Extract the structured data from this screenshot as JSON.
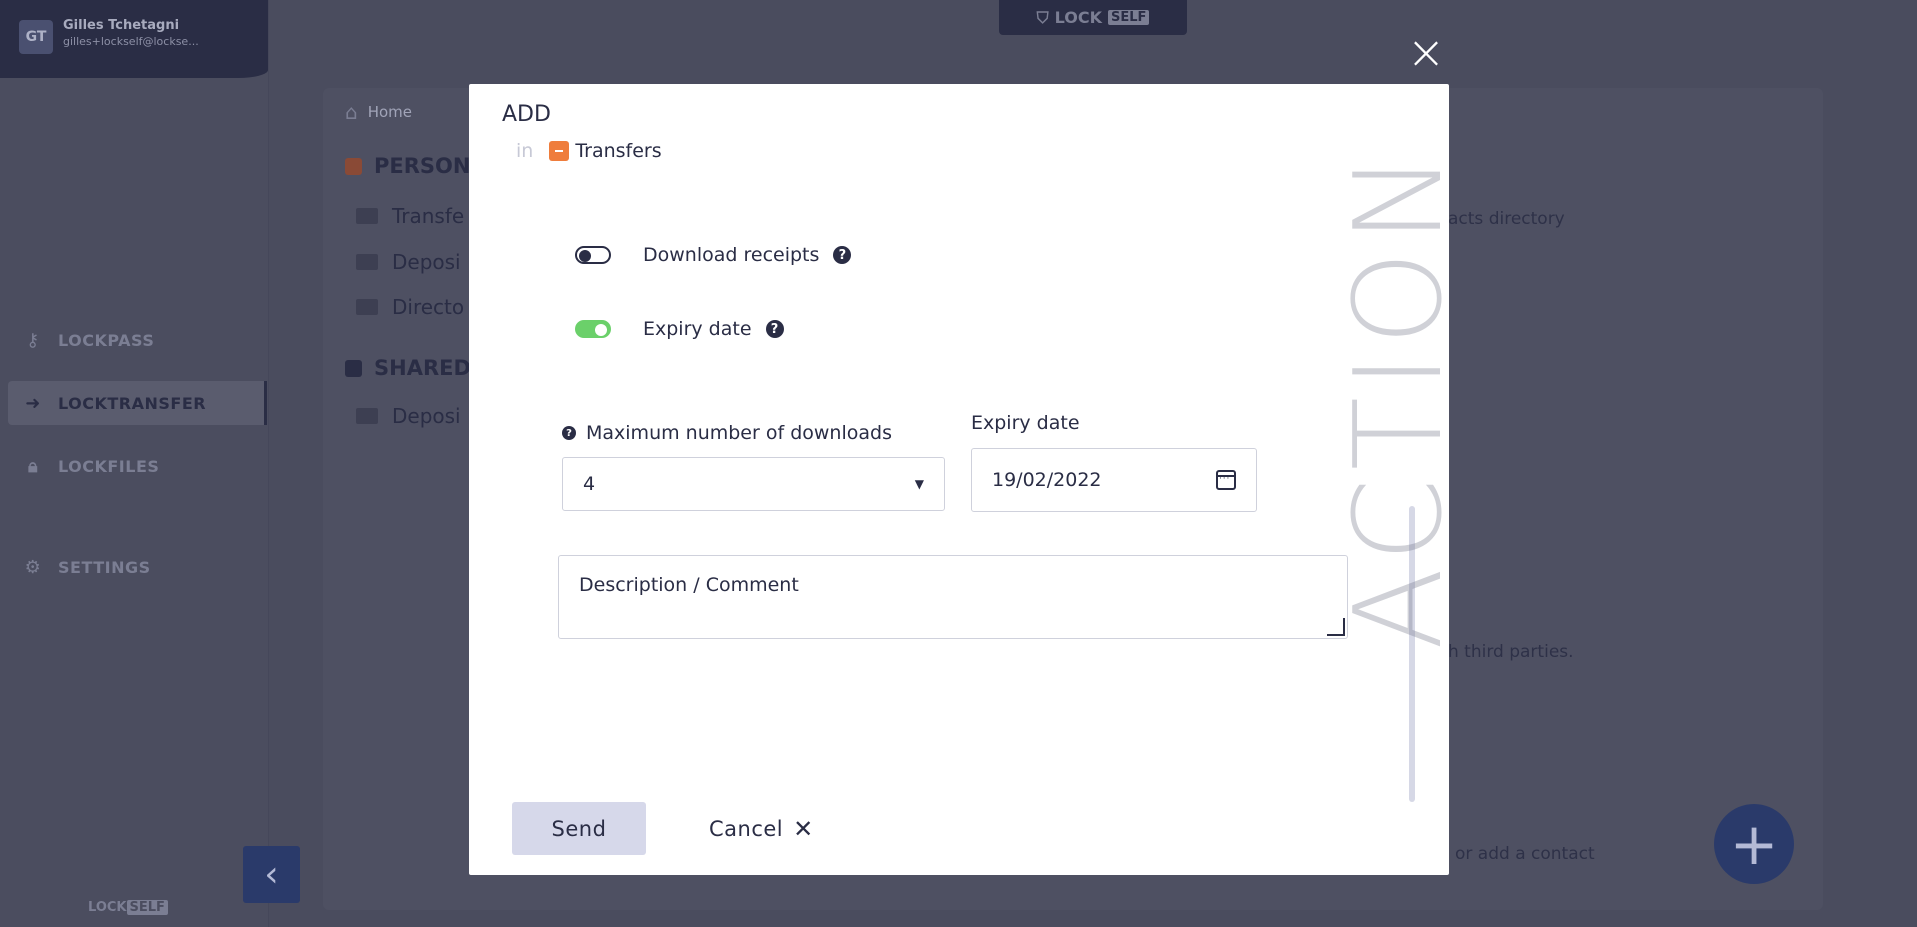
{
  "user": {
    "initials": "GT",
    "name": "Gilles Tchetagni",
    "email": "gilles+lockself@lockse..."
  },
  "brand": {
    "lock": "LOCK",
    "self": "SELF"
  },
  "sidebar": {
    "items": [
      {
        "label": "LOCKPASS",
        "icon": "key-icon"
      },
      {
        "label": "LOCKTRANSFER",
        "icon": "arrow-right-icon",
        "active": true
      },
      {
        "label": "LOCKFILES",
        "icon": "lock-icon"
      },
      {
        "label": "SETTINGS",
        "icon": "gears-icon"
      }
    ],
    "collapse_glyph": "‹"
  },
  "background": {
    "breadcrumb_home": "Home",
    "personal_section": "PERSON",
    "personal_folders": [
      "Transfe",
      "Deposi",
      "Directo"
    ],
    "shared_section": "SHARED",
    "shared_folders": [
      "Deposi"
    ],
    "text_contacts": "acts directory",
    "text_third_parties": "h third parties.",
    "text_add_contact": "or add a contact",
    "watermark": "ACTION",
    "fab_glyph": "+"
  },
  "modal": {
    "close_glyph": "×",
    "title": "ADD",
    "in_word": "in",
    "folder": "Transfers",
    "download_receipts_label": "Download receipts",
    "download_receipts_on": false,
    "expiry_toggle_label": "Expiry date",
    "expiry_toggle_on": true,
    "help_glyph": "?",
    "max_downloads_label": "Maximum number of downloads",
    "max_downloads_value": "4",
    "expiry_field_label": "Expiry date",
    "expiry_value": "19/02/2022",
    "description_placeholder": "Description / Comment",
    "send_label": "Send",
    "cancel_label": "Cancel",
    "cancel_glyph": "✕"
  },
  "colors": {
    "navy": "#2a2d45",
    "toggle_on": "#6bd06a",
    "folder_tag": "#ef7d3c",
    "send_bg": "#d6d8ea"
  }
}
